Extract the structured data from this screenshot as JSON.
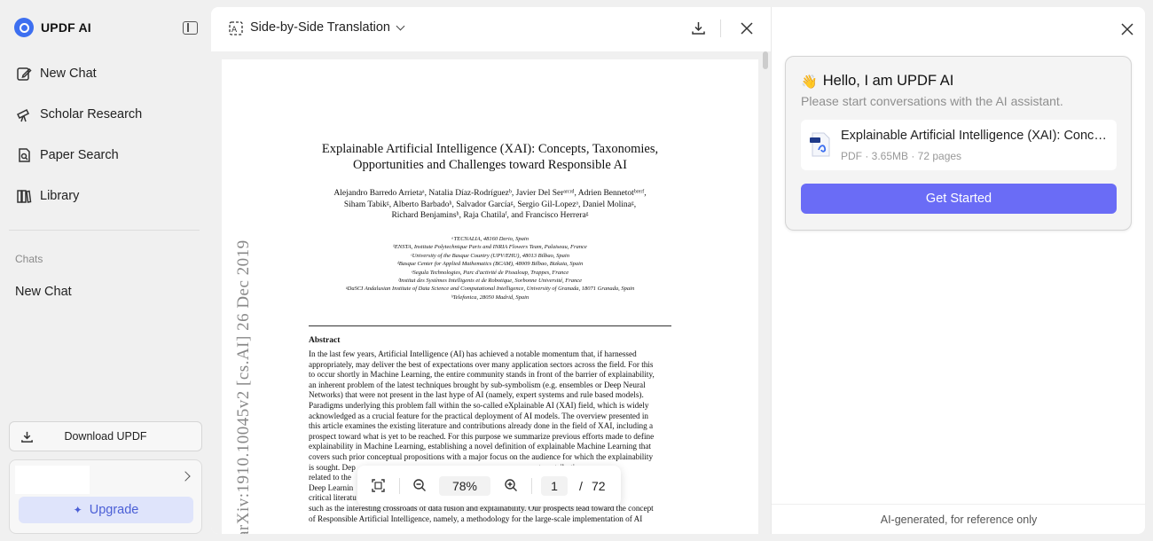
{
  "sidebar": {
    "brand": "UPDF AI",
    "nav": [
      {
        "label": "New Chat",
        "icon": "new-chat-icon"
      },
      {
        "label": "Scholar Research",
        "icon": "telescope-icon"
      },
      {
        "label": "Paper Search",
        "icon": "paper-search-icon"
      },
      {
        "label": "Library",
        "icon": "library-icon"
      }
    ],
    "chats_label": "Chats",
    "chats": [
      "New Chat"
    ],
    "download_label": "Download UPDF",
    "upgrade_label": "Upgrade"
  },
  "doc": {
    "mode_label": "Side-by-Side Translation",
    "paper": {
      "title_line1": "Explainable Artificial Intelligence (XAI): Concepts, Taxonomies,",
      "title_line2": "Opportunities and Challenges toward Responsible AI",
      "authors_line1": "Alejandro Barredo Arrietaᵃ, Natalia Díaz-Rodríguezᵇ, Javier Del Serᵃʳᶜʳᵈ, Adrien Bennetotᵇʳᵉʳᶠ,",
      "authors_line2": "Siham Tabikᵍ, Alberto Barbadoʰ, Salvador Garcíaᵍ, Sergio Gil-Lopezᵃ, Daniel Molinaᵍ,",
      "authors_line3": "Richard Benjaminsʰ, Raja Chatilaᶠ, and Francisco Herreraᵍ",
      "affiliations": [
        "ᵃTECNALIA, 48160 Derio, Spain",
        "ᵇENSTA, Institute Polytechnique Paris and INRIA Flowers Team, Palaiseau, France",
        "ᶜUniversity of the Basque Country (UPV/EHU), 48013 Bilbao, Spain",
        "ᵈBasque Center for Applied Mathematics (BCAM), 48009 Bilbao, Bizkaia, Spain",
        "ᵉSegula Technologies, Parc d'activité de Pissaloup, Trappes, France",
        "ᶠInstitut des Systèmes Intelligents et de Robotique, Sorbonne Université, France",
        "ᵍDaSCI Andalusian Institute of Data Science and Computational Intelligence, University of Granada, 18071 Granada, Spain",
        "ʰTelefonica, 28050 Madrid, Spain"
      ],
      "abstract_heading": "Abstract",
      "abstract_lines": [
        "In the last few years, Artificial Intelligence (AI) has achieved a notable momentum that, if harnessed",
        "appropriately, may deliver the best of expectations over many application sectors across the field. For this",
        "to occur shortly in Machine Learning, the entire community stands in front of the barrier of explainability,",
        "an inherent problem of the latest techniques brought by sub-symbolism (e.g. ensembles or Deep Neural",
        "Networks) that were not present in the last hype of AI (namely, expert systems and rule based models).",
        "Paradigms underlying this problem fall within the so-called eXplainable AI (XAI) field, which is widely",
        "acknowledged as a crucial feature for the practical deployment of AI models. The overview presented in",
        "this article examines the existing literature and contributions already done in the field of XAI, including a",
        "prospect toward what is yet to be reached. For this purpose we summarize previous efforts made to define",
        "explainability in Machine Learning, establishing a novel definition of explainable Machine Learning that",
        "covers such prior conceptual propositions with a major focus on the audience for which the explainability",
        "is sought. Dep                                                                                          t contributions",
        "related to the                                                                                          d at explaining",
        "Deep Learnin                                                                                            n detail. This",
        "critical literatu                                                                                       faced by XAI,",
        "such as the interesting crossroads of data fusion and explainability. Our prospects lead toward the concept",
        "of Responsible Artificial Intelligence, namely, a methodology for the large-scale implementation of AI"
      ],
      "arxiv_stamp": "arXiv:1910.10045v2  [cs.AI]  26 Dec 2019"
    },
    "zoom": "78%",
    "page_current": "1",
    "page_sep": "/",
    "page_total": "72"
  },
  "ai": {
    "greeting": "Hello, I am UPDF AI",
    "subtitle": "Please start conversations with the AI assistant.",
    "file_name": "Explainable Artificial Intelligence (XAI): Conce...",
    "file_meta": "PDF · 3.65MB · 72 pages",
    "start_label": "Get Started",
    "footer": "AI-generated, for reference only"
  },
  "colors": {
    "accent": "#6a6cf6",
    "brand": "#3d6ff0",
    "upgrade_bg": "#dfe4fb"
  }
}
